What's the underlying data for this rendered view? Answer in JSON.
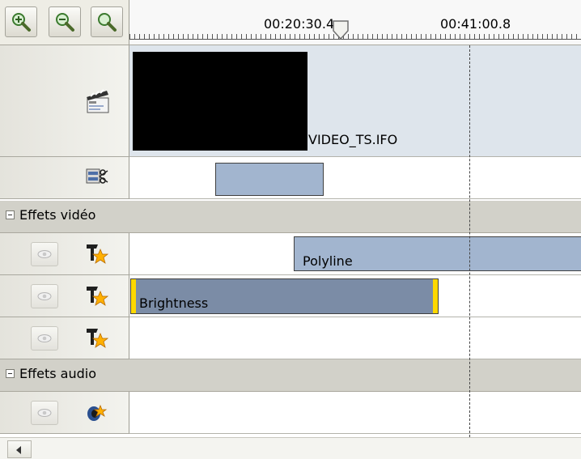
{
  "toolbar": {
    "zoom_in_icon": "zoom-in-icon",
    "zoom_out_icon": "zoom-out-icon",
    "zoom_fit_icon": "zoom-fit-icon"
  },
  "ruler": {
    "time_1": "00:20:30.4",
    "time_2": "00:41:00.8"
  },
  "video_track": {
    "clip_label": "VIDEO_TS.IFO",
    "icon": "clapperboard-icon"
  },
  "cut_track": {
    "icon": "scissors-icon"
  },
  "video_effects": {
    "section_label": "Effets vidéo",
    "tracks": [
      {
        "clip_label": "Polyline"
      },
      {
        "clip_label": "Brightness"
      },
      {
        "clip_label": ""
      }
    ]
  },
  "audio_effects": {
    "section_label": "Effets audio"
  },
  "colors": {
    "clip_light": "#a2b5cf",
    "clip_dark": "#7b8ca6",
    "marker_yellow": "#ffd800",
    "track_bg": "#e0e7ef",
    "section_bg": "#d2d1c9"
  }
}
